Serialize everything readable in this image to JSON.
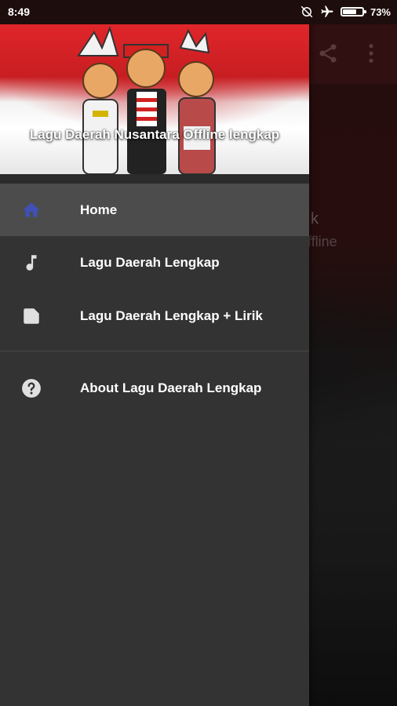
{
  "status_bar": {
    "time": "8:49",
    "battery_percent": "73%",
    "battery_level": 0.73,
    "icons": [
      "sync-off-icon",
      "airplane-icon",
      "battery-icon"
    ]
  },
  "background_screen": {
    "title_fragment": "k",
    "subtitle_fragment": "ffline",
    "toolbar_icons": [
      "share-icon",
      "more-vert-icon"
    ]
  },
  "drawer": {
    "header_title": "Lagu Daerah Nusantara Offline lengkap",
    "items": [
      {
        "label": "Home",
        "icon": "home-icon",
        "active": true
      },
      {
        "label": "Lagu Daerah Lengkap",
        "icon": "music-note-icon",
        "active": false
      },
      {
        "label": "Lagu Daerah Lengkap + Lirik",
        "icon": "note-icon",
        "active": false
      },
      {
        "label": "About Lagu Daerah Lengkap",
        "icon": "help-icon",
        "active": false
      }
    ]
  },
  "colors": {
    "accent": "#3f51b5",
    "drawer_bg": "#333333",
    "active_item_bg": "#4c4c4c",
    "header_red": "#c81e22"
  }
}
